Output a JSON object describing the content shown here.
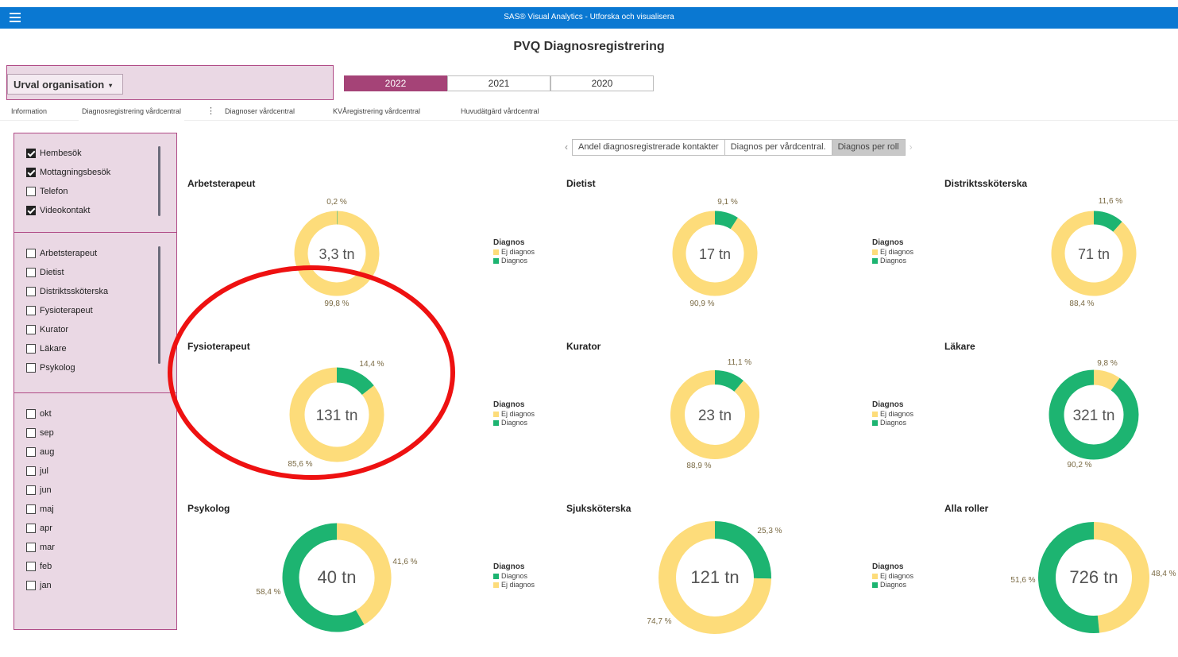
{
  "colors": {
    "app_bar": "#0a78d2",
    "accent": "#a54377",
    "filter_bg": "#ead8e4",
    "filter_border": "#b04a86",
    "diagnos": "#1db471",
    "ej_diagnos": "#fddc7a",
    "highlight_ring": "#ee1111"
  },
  "app": {
    "title": "SAS® Visual Analytics - Utforska och visualisera",
    "menu_icon": "hamburger-menu-icon"
  },
  "report": {
    "title": "PVQ Diagnosregistrering"
  },
  "org": {
    "dropdown_label": "Urval organisation",
    "caret": "▾"
  },
  "years": [
    {
      "label": "2022",
      "active": true
    },
    {
      "label": "2021",
      "active": false
    },
    {
      "label": "2020",
      "active": false
    }
  ],
  "tabs": [
    {
      "label": "Information"
    },
    {
      "label": "Diagnosregistrering vårdcentral",
      "active": true
    },
    {
      "label": "Diagnoser vårdcentral"
    },
    {
      "label": "KVÅregistrering vårdcentral"
    },
    {
      "label": "Huvudätgärd vårdcentral"
    }
  ],
  "tab_more_icon": "⋮",
  "filters": {
    "contact_types": [
      {
        "label": "Hembesök",
        "checked": true
      },
      {
        "label": "Mottagningsbesök",
        "checked": true
      },
      {
        "label": "Telefon",
        "checked": false
      },
      {
        "label": "Videokontakt",
        "checked": true
      }
    ],
    "roles": [
      {
        "label": "Arbetsterapeut",
        "checked": false
      },
      {
        "label": "Dietist",
        "checked": false
      },
      {
        "label": "Distriktssköterska",
        "checked": false
      },
      {
        "label": "Fysioterapeut",
        "checked": false
      },
      {
        "label": "Kurator",
        "checked": false
      },
      {
        "label": "Läkare",
        "checked": false
      },
      {
        "label": "Psykolog",
        "checked": false
      }
    ],
    "months": [
      {
        "label": "okt",
        "checked": false
      },
      {
        "label": "sep",
        "checked": false
      },
      {
        "label": "aug",
        "checked": false
      },
      {
        "label": "jul",
        "checked": false
      },
      {
        "label": "jun",
        "checked": false
      },
      {
        "label": "maj",
        "checked": false
      },
      {
        "label": "apr",
        "checked": false
      },
      {
        "label": "mar",
        "checked": false
      },
      {
        "label": "feb",
        "checked": false
      },
      {
        "label": "jan",
        "checked": false
      }
    ]
  },
  "nav": {
    "prev_icon": "‹",
    "next_icon": "›",
    "buttons": [
      {
        "label": "Andel diagnosregistrerade kontakter",
        "active": false
      },
      {
        "label": "Diagnos per vårdcentral.",
        "active": false
      },
      {
        "label": "Diagnos per roll",
        "active": true
      }
    ]
  },
  "legend": {
    "title": "Diagnos",
    "ej_label": "Ej diagnos",
    "diag_label": "Diagnos"
  },
  "chart_data": [
    {
      "type": "pie",
      "title": "Arbetsterapeut",
      "center_label": "3,3 tn",
      "slices": [
        {
          "name": "Diagnos",
          "value": 0.2,
          "label": "0,2 %"
        },
        {
          "name": "Ej diagnos",
          "value": 99.8,
          "label": "99,8 %"
        }
      ],
      "legend_order": [
        "Ej diagnos",
        "Diagnos"
      ]
    },
    {
      "type": "pie",
      "title": "Dietist",
      "center_label": "17 tn",
      "slices": [
        {
          "name": "Diagnos",
          "value": 9.1,
          "label": "9,1 %"
        },
        {
          "name": "Ej diagnos",
          "value": 90.9,
          "label": "90,9 %"
        }
      ],
      "legend_order": [
        "Ej diagnos",
        "Diagnos"
      ]
    },
    {
      "type": "pie",
      "title": "Distriktssköterska",
      "center_label": "71 tn",
      "slices": [
        {
          "name": "Diagnos",
          "value": 11.6,
          "label": "11,6 %"
        },
        {
          "name": "Ej diagnos",
          "value": 88.4,
          "label": "88,4 %"
        }
      ],
      "legend_order": []
    },
    {
      "type": "pie",
      "title": "Fysioterapeut",
      "center_label": "131 tn",
      "slices": [
        {
          "name": "Diagnos",
          "value": 14.4,
          "label": "14,4 %"
        },
        {
          "name": "Ej diagnos",
          "value": 85.6,
          "label": "85,6 %"
        }
      ],
      "legend_order": [
        "Ej diagnos",
        "Diagnos"
      ]
    },
    {
      "type": "pie",
      "title": "Kurator",
      "center_label": "23 tn",
      "slices": [
        {
          "name": "Diagnos",
          "value": 11.1,
          "label": "11,1 %"
        },
        {
          "name": "Ej diagnos",
          "value": 88.9,
          "label": "88,9 %"
        }
      ],
      "legend_order": [
        "Ej diagnos",
        "Diagnos"
      ]
    },
    {
      "type": "pie",
      "title": "Läkare",
      "center_label": "321 tn",
      "slices": [
        {
          "name": "Ej diagnos",
          "value": 9.8,
          "label": "9,8 %"
        },
        {
          "name": "Diagnos",
          "value": 90.2,
          "label": "90,2 %"
        }
      ],
      "legend_order": []
    },
    {
      "type": "pie",
      "title": "Psykolog",
      "center_label": "40 tn",
      "slices": [
        {
          "name": "Ej diagnos",
          "value": 41.6,
          "label": "41,6 %"
        },
        {
          "name": "Diagnos",
          "value": 58.4,
          "label": "58,4 %"
        }
      ],
      "legend_order": [
        "Diagnos",
        "Ej diagnos"
      ]
    },
    {
      "type": "pie",
      "title": "Sjuksköterska",
      "center_label": "121 tn",
      "slices": [
        {
          "name": "Diagnos",
          "value": 25.3,
          "label": "25,3 %"
        },
        {
          "name": "Ej diagnos",
          "value": 74.7,
          "label": "74,7 %"
        }
      ],
      "legend_order": [
        "Ej diagnos",
        "Diagnos"
      ]
    },
    {
      "type": "pie",
      "title": "Alla roller",
      "center_label": "726 tn",
      "slices": [
        {
          "name": "Ej diagnos",
          "value": 48.4,
          "label": "48,4 %"
        },
        {
          "name": "Diagnos",
          "value": 51.6,
          "label": "51,6 %"
        }
      ],
      "legend_order": []
    }
  ]
}
